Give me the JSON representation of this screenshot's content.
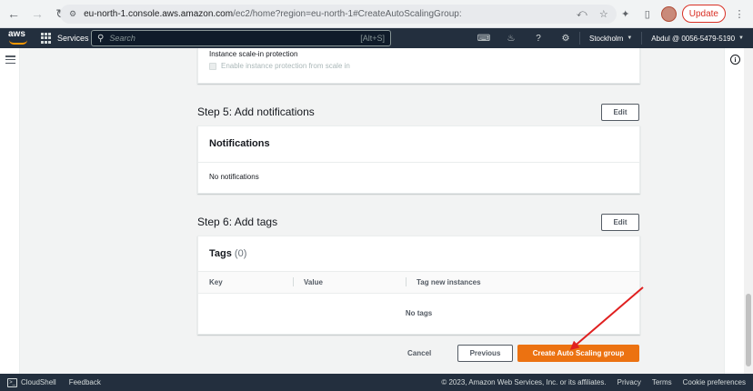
{
  "browser": {
    "url_host": "eu-north-1.console.aws.amazon.com",
    "url_path": "/ec2/home?region=eu-north-1#CreateAutoScalingGroup:",
    "update_label": "Update"
  },
  "aws_header": {
    "logo": "aws",
    "services_label": "Services",
    "search_placeholder": "Search",
    "search_shortcut": "[Alt+S]",
    "region": "Stockholm",
    "account": "Abdul @ 0056-5479-5190"
  },
  "top_card": {
    "label": "Instance scale-in protection",
    "checkbox_label": "Enable instance protection from scale in"
  },
  "step5": {
    "title": "Step 5: Add notifications",
    "edit_label": "Edit",
    "card_title": "Notifications",
    "empty_text": "No notifications"
  },
  "step6": {
    "title": "Step 6: Add tags",
    "edit_label": "Edit",
    "card_title": "Tags",
    "count": "(0)",
    "columns": [
      "Key",
      "Value",
      "Tag new instances"
    ],
    "empty_text": "No tags"
  },
  "actions": {
    "cancel": "Cancel",
    "previous": "Previous",
    "create": "Create Auto Scaling group"
  },
  "footer": {
    "cloudshell": "CloudShell",
    "feedback": "Feedback",
    "copyright": "© 2023, Amazon Web Services, Inc. or its affiliates.",
    "privacy": "Privacy",
    "terms": "Terms",
    "cookies": "Cookie preferences"
  },
  "colors": {
    "primary_button": "#ec7211",
    "aws_navbar": "#232f3e",
    "annotation_arrow": "#e02020"
  }
}
